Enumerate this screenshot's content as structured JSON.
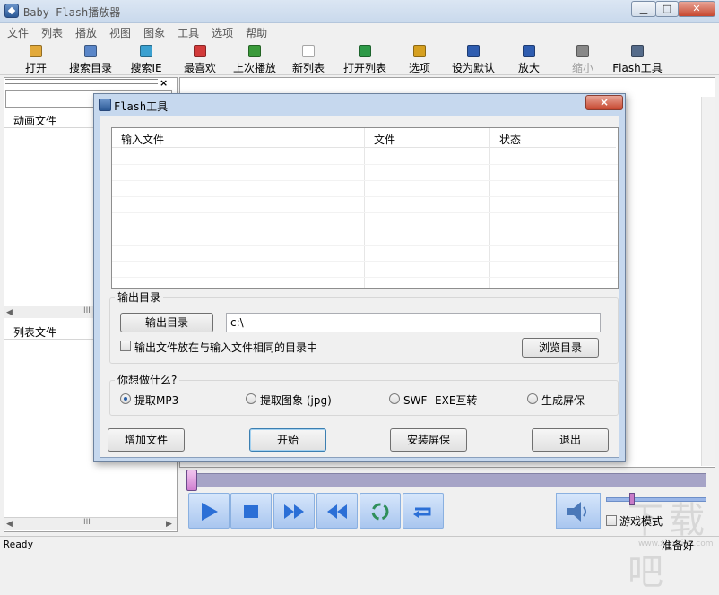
{
  "app": {
    "title": "Baby Flash播放器"
  },
  "menu": [
    "文件",
    "列表",
    "播放",
    "视图",
    "图象",
    "工具",
    "选项",
    "帮助"
  ],
  "toolbar": [
    {
      "label": "打开",
      "icon": "open-folder-icon",
      "color": "#e2a93a"
    },
    {
      "label": "搜索目录",
      "icon": "search-folder-icon",
      "color": "#5a86c8"
    },
    {
      "label": "搜索IE",
      "icon": "globe-icon",
      "color": "#3aa0d0"
    },
    {
      "label": "最喜欢",
      "icon": "heart-icon",
      "color": "#d23a3a"
    },
    {
      "label": "上次播放",
      "icon": "replay-icon",
      "color": "#3a9a3a"
    },
    {
      "label": "新列表",
      "icon": "new-document-icon",
      "color": "#ffffff"
    },
    {
      "label": "打开列表",
      "icon": "open-list-icon",
      "color": "#2e9a48"
    },
    {
      "label": "选项",
      "icon": "options-icon",
      "color": "#d6a020"
    },
    {
      "label": "设为默认",
      "icon": "monitor-icon",
      "color": "#2f5db0"
    },
    {
      "label": "放大",
      "icon": "zoom-in-icon",
      "color": "#2f5db0"
    },
    {
      "label": "缩小",
      "icon": "zoom-out-icon",
      "color": "#888888",
      "disabled": true
    },
    {
      "label": "Flash工具",
      "icon": "tools-icon",
      "color": "#556b8a"
    }
  ],
  "left": {
    "close_glyph": "×",
    "anim_header": "动画文件",
    "list_header": "列表文件"
  },
  "player": {
    "game_mode_label": "游戏模式"
  },
  "status": {
    "left": "Ready",
    "right": "准备好"
  },
  "dialog": {
    "title": "Flash工具",
    "close_glyph": "×",
    "columns": [
      "输入文件",
      "文件",
      "状态"
    ],
    "output_group": "输出目录",
    "output_button": "输出目录",
    "output_path": "c:\\",
    "same_dir_label": "输出文件放在与输入文件相同的目录中",
    "browse_button": "浏览目录",
    "task_group": "你想做什么?",
    "options": [
      "提取MP3",
      "提取图象 (jpg)",
      "SWF--EXE互转",
      "生成屏保"
    ],
    "selected_option": 0,
    "buttons": {
      "add": "增加文件",
      "start": "开始",
      "install": "安装屏保",
      "exit": "退出"
    }
  },
  "watermark": {
    "text": "下载吧",
    "sub": "www.xiazaiba.com"
  }
}
